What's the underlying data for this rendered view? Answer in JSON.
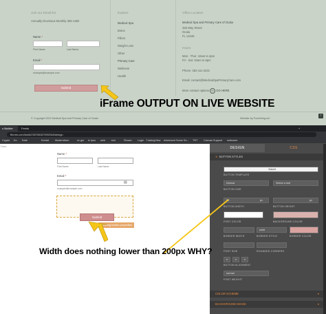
{
  "site": {
    "join_text": "Join our Email list",
    "join_sub": "Annually Devinious Monthly 305-1482",
    "name_label": "Name",
    "required_mark": "*",
    "first_label": "First Name",
    "last_label": "Last Name",
    "email_label": "Email",
    "email_hint": "example@example.com",
    "submit_label": "Submit",
    "explore_heading": "Explore",
    "explore_items": [
      "Medical Spa",
      "Botox",
      "Fillers",
      "Weight Loss",
      "Other",
      "Primary Care",
      "Wellness",
      "Health"
    ],
    "office_heading": "Office Location",
    "office_name": "Medical Spa and Primary Care of Ocala",
    "office_addr1": "325 Way Street",
    "office_addr2": "Ocala",
    "office_addr3": "FL 12345",
    "hours_heading": "Hours",
    "hours_1": "Mon - Thur: 10am to 4pm",
    "hours_2": "Fri - Sat: 10am to 6pm",
    "phone": "Phone: 352-111-2222",
    "email": "Email: contact@MedicalSpaPrimaryCare.com",
    "more_options": "More contact options",
    "go_here": "GO HERE",
    "copyright": "© Copyright 2022 Medical Spa and Primary Care of Ocala",
    "credit": "Website by Fourthring.me"
  },
  "caption_top": "iFrame OUTPUT ON LIVE WEBSITE",
  "caption_bottom": "Width does nothing lower than 200px WHY?",
  "browser": {
    "tabs": [
      "o Builder",
      "Feeds",
      "",
      "",
      "",
      "",
      "",
      "",
      "",
      "",
      "",
      "",
      "",
      "",
      "",
      "",
      "",
      "",
      "",
      "",
      ""
    ],
    "url": "fforms.com/build/230786327892048/design",
    "bookmarks": [
      "Crypto",
      "Ko",
      "Kate",
      "Kohait",
      "Modernform",
      "sv gm",
      "tv ipsu",
      "web",
      "tvsi",
      "Shown",
      "Login - TradingView",
      "Advanced Some Se...",
      "TNT",
      "Canvas Support",
      "smbosee"
    ]
  },
  "canvas": {
    "side_label": "Form",
    "name_label": "Name",
    "first_label": "First Name",
    "last_label": "Last Name",
    "email_label": "Email",
    "email_hint": "example@example.com",
    "submit_label": "Submit",
    "tooltip": "Showing button properties"
  },
  "panel": {
    "tab_design": "DESIGN",
    "tab_css": "CSS",
    "section_button_styles": "BUTTON STYLES",
    "preview_label": "Submit",
    "button_template_label": "BUTTON TEMPLATE",
    "style_value": "Normal",
    "font_value": "Select a font",
    "button_size_label": "BUTTON SIZE",
    "width_value": "50",
    "width_unit": "px",
    "height_unit": "px",
    "button_width_label": "BUTTON WIDTH",
    "button_height_label": "BUTTON HEIGHT",
    "font_color_label": "FONT COLOR",
    "bg_color_label": "BACKGROUND COLOR",
    "border_width_label": "BORDER WIDTH",
    "border_style_value": "solid",
    "border_style_label": "BORDER STYLE",
    "border_color_label": "BORDER COLOR",
    "font_size_label": "FONT SIZE",
    "rounded_label": "ROUNDED CORNERS",
    "alignment_label": "BUTTON ALIGNMENT",
    "weight_value": "normal",
    "font_weight_label": "FONT WEIGHT",
    "color_scheme": "COLOR SCHEME",
    "background_image": "BACKGROUND IMAGE",
    "font_color": "#ffffff",
    "bg_color": "#d9b2ae",
    "border_color": "#d9a3a0"
  },
  "colors": {
    "site_bg": "#c9d3c8",
    "submit_pink": "#d19c9c",
    "arrow_yellow": "#f5c518",
    "panel_orange": "#e8883c"
  }
}
